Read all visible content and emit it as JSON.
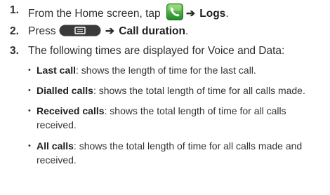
{
  "steps": [
    {
      "num": "1.",
      "text_before": "From the Home screen, tap ",
      "arrow": "➔",
      "target": "Logs",
      "text_after": "."
    },
    {
      "num": "2.",
      "text_before": "Press ",
      "arrow": "➔",
      "target": "Call duration",
      "text_after": "."
    },
    {
      "num": "3.",
      "text": "The following times are displayed for Voice and Data:"
    }
  ],
  "bullets": [
    {
      "term": "Last call",
      "desc": ": shows the length of time for the last call."
    },
    {
      "term": "Dialled calls",
      "desc": ": shows the total length of time for all calls made."
    },
    {
      "term": "Received calls",
      "desc": ": shows the total length of time for all calls received."
    },
    {
      "term": "All calls",
      "desc": ": shows the total length of time for all calls made and received."
    }
  ],
  "bullet_symbol": "•",
  "icons": {
    "phone": "phone-app-icon",
    "menu": "menu-key-icon",
    "phone_color": "#2e9b2e",
    "key_color": "#3a3a3a"
  }
}
